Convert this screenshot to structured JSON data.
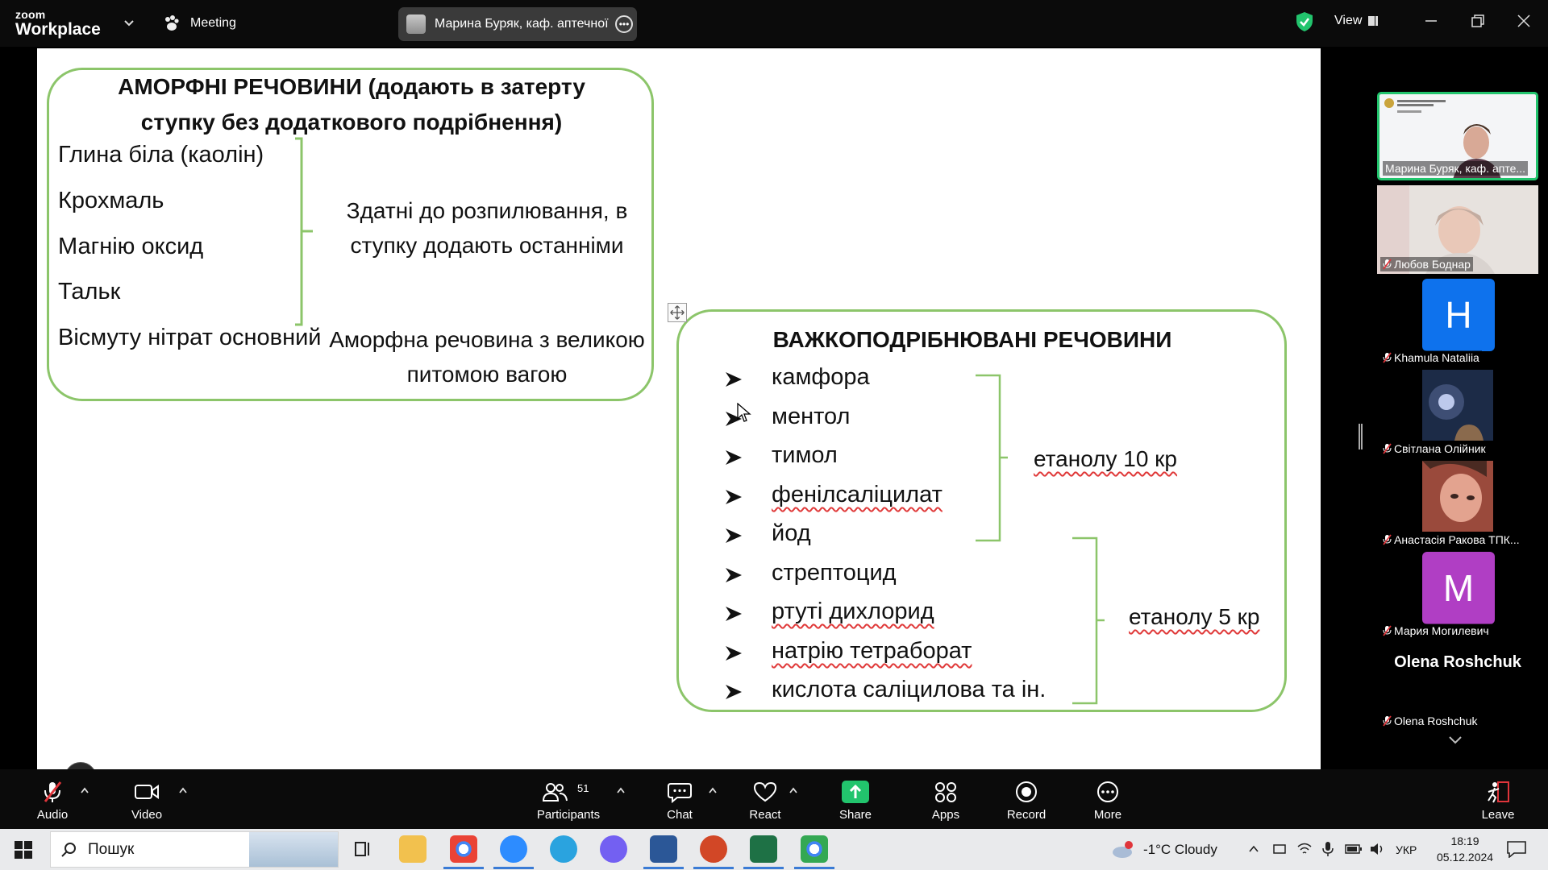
{
  "app": {
    "logo_small": "zoom",
    "logo_big": "Workplace",
    "meeting_label": "Meeting",
    "speaker_name": "Марина Буряк, каф. аптечної те",
    "view_label": "View",
    "colors": {
      "accent_green": "#22c46d",
      "bg": "#0b0b0b",
      "slide_green": "#8cc56a"
    }
  },
  "slide": {
    "box1": {
      "title": "АМОРФНІ РЕЧОВИНИ (додають в затерту ступку без додаткового подрібнення)",
      "items": [
        "Глина біла (каолін)",
        "Крохмаль",
        "Магнію оксид",
        "Тальк",
        "Вісмуту нітрат основний"
      ],
      "note1": "Здатні до розпилювання, в ступку додають останніми",
      "note2": "Аморфна речовина з великою питомою вагою"
    },
    "box2": {
      "title": "ВАЖКОПОДРІБНЮВАНІ РЕЧОВИНИ",
      "items": [
        "камфора",
        "ментол",
        "тимол",
        "фенілсаліцилат",
        "йод",
        "стрептоцид",
        "ртуті дихлорид",
        "натрію тетраборат",
        "кислота саліцилова та ін."
      ],
      "note1": "етанолу 10 кр",
      "note2": "етанолу 5 кр"
    }
  },
  "gallery": [
    {
      "name": "Марина Буряк, каф. апте...",
      "muted": false,
      "type": "video",
      "active": true
    },
    {
      "name": "Любов Боднар",
      "muted": true,
      "type": "video"
    },
    {
      "name": "Khamula Nataliia",
      "muted": true,
      "type": "letter",
      "letter": "H",
      "color": "#0e72ed"
    },
    {
      "name": "Світлана Олійник",
      "muted": true,
      "type": "video"
    },
    {
      "name": "Анастасія Ракова ТПК...",
      "muted": true,
      "type": "video"
    },
    {
      "name": "Мария Могилевич",
      "muted": true,
      "type": "letter",
      "letter": "M",
      "color": "#b03ec4"
    },
    {
      "name": "Olena Roshchuk",
      "muted": true,
      "type": "bigname",
      "display": "Olena Roshchuk"
    }
  ],
  "toolbar": {
    "audio": "Audio",
    "video": "Video",
    "participants": "Participants",
    "participants_count": "51",
    "chat": "Chat",
    "react": "React",
    "share": "Share",
    "apps": "Apps",
    "record": "Record",
    "more": "More",
    "leave": "Leave"
  },
  "taskbar": {
    "search_placeholder": "Пошук",
    "weather": "-1°C  Cloudy",
    "weather_badge": "1",
    "lang": "УКР",
    "time": "18:19",
    "date": "05.12.2024"
  }
}
